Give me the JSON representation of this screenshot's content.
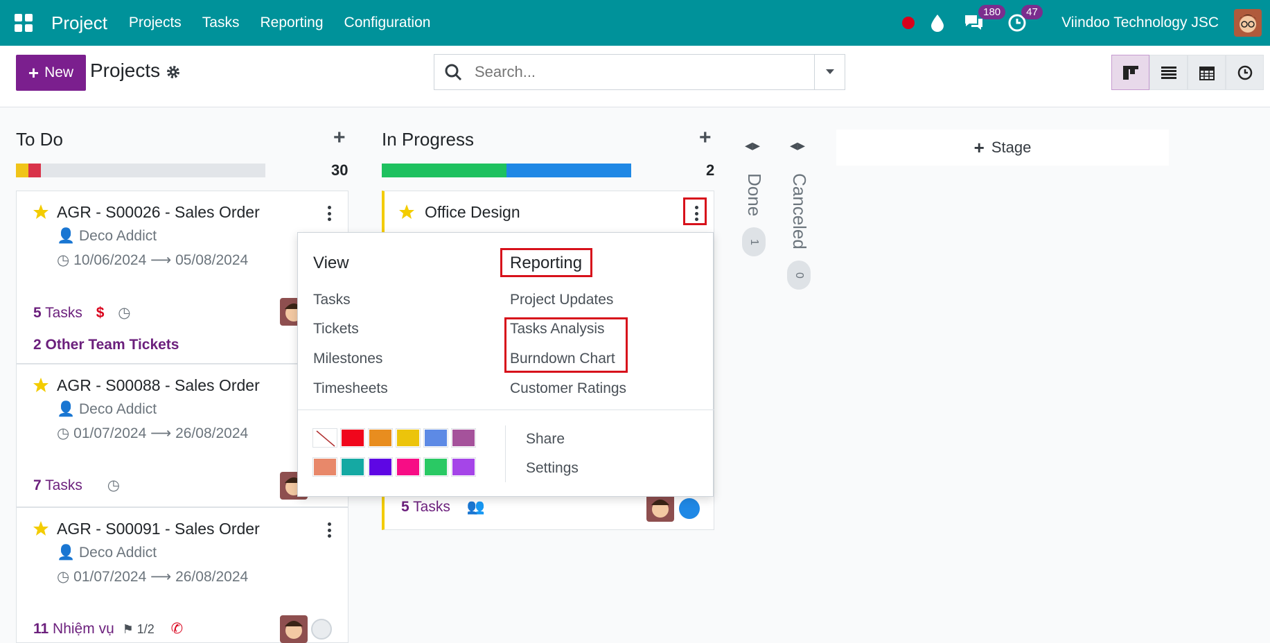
{
  "navbar": {
    "brand": "Project",
    "menu": [
      "Projects",
      "Tasks",
      "Reporting",
      "Configuration"
    ],
    "messages_count": "180",
    "activities_count": "47",
    "company": "Viindoo Technology JSC"
  },
  "control": {
    "new_label": "New",
    "title": "Projects",
    "search_placeholder": "Search..."
  },
  "columns": {
    "todo": {
      "title": "To Do",
      "count": "30",
      "progress": [
        {
          "color": "#f0c419",
          "fraction": 0.05
        },
        {
          "color": "#d9334a",
          "fraction": 0.05
        }
      ],
      "cards": [
        {
          "title": "AGR - S00026 - Sales Order",
          "customer": "Deco Addict",
          "date_start": "10/06/2024",
          "date_end": "05/08/2024",
          "tasks_count": "5",
          "tasks_label": "Tasks",
          "extra": "2 Other Team Tickets"
        },
        {
          "title": "AGR - S00088 - Sales Order",
          "customer": "Deco Addict",
          "date_start": "01/07/2024",
          "date_end": "26/08/2024",
          "tasks_count": "7",
          "tasks_label": "Tasks"
        },
        {
          "title": "AGR - S00091 - Sales Order",
          "customer": "Deco Addict",
          "date_start": "01/07/2024",
          "date_end": "26/08/2024",
          "tasks_count": "11",
          "tasks_label": "Nhiệm vụ",
          "milestone": "1/2"
        }
      ]
    },
    "inprogress": {
      "title": "In Progress",
      "count": "2",
      "progress": [
        {
          "color": "#1ec15f",
          "fraction": 0.5
        },
        {
          "color": "#1f88e5",
          "fraction": 0.5
        }
      ],
      "cards": [
        {
          "title": "Office Design",
          "tasks_count": "5",
          "tasks_label": "Tasks"
        }
      ]
    },
    "done": {
      "title": "Done",
      "count": "1"
    },
    "canceled": {
      "title": "Canceled",
      "count": "0"
    },
    "add_stage": "Stage"
  },
  "dropdown": {
    "view_header": "View",
    "view_items": [
      "Tasks",
      "Tickets",
      "Milestones",
      "Timesheets"
    ],
    "reporting_header": "Reporting",
    "reporting_items": [
      "Project Updates",
      "Tasks Analysis",
      "Burndown Chart",
      "Customer Ratings"
    ],
    "actions": [
      "Share",
      "Settings"
    ],
    "colors": [
      "#ffffff",
      "#f0061c",
      "#e88d1f",
      "#ecc40b",
      "#5d8ae5",
      "#a5529b",
      "#e8886a",
      "#15a9a3",
      "#5e06e4",
      "#f70d85",
      "#2ac964",
      "#a545e8"
    ]
  }
}
